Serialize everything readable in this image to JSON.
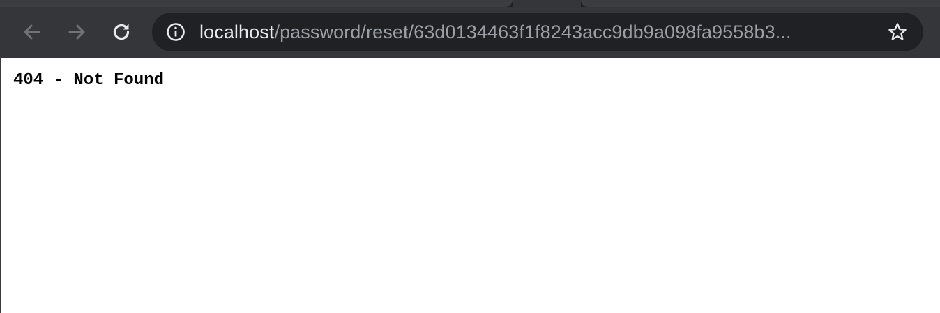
{
  "browser": {
    "address_bar": {
      "host": "localhost",
      "path": "/password/reset/63d0134463f1f8243acc9db9a098fa9558b3..."
    },
    "icons": {
      "back": "back-arrow-icon",
      "forward": "forward-arrow-icon",
      "reload": "reload-icon",
      "site_info": "info-icon",
      "bookmark": "star-icon"
    },
    "colors": {
      "toolbar": "#35363a",
      "omnibox": "#202124",
      "host_text": "#e8eaed",
      "path_text": "#9aa0a6"
    }
  },
  "page": {
    "message": "404 - Not Found"
  }
}
